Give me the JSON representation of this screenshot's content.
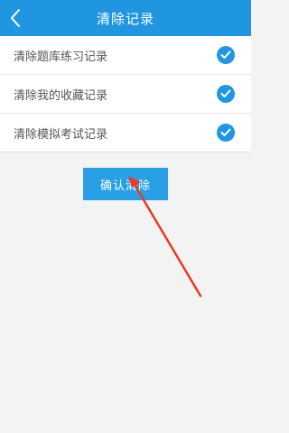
{
  "header": {
    "title": "清除记录",
    "back_icon": "chevron-left-icon"
  },
  "options": [
    {
      "label": "清除题库练习记录",
      "checked": true
    },
    {
      "label": "清除我的收藏记录",
      "checked": true
    },
    {
      "label": "清除模拟考试记录",
      "checked": true
    }
  ],
  "confirm_button": {
    "label": "确认清除"
  },
  "annotation": {
    "icon": "red-arrow-annotation"
  },
  "colors": {
    "header_bg": "#2196e0",
    "button_bg": "#29a0e6",
    "check": "#2196e0",
    "annotation": "#e83a2a",
    "page_bg": "#f3f3f3"
  }
}
